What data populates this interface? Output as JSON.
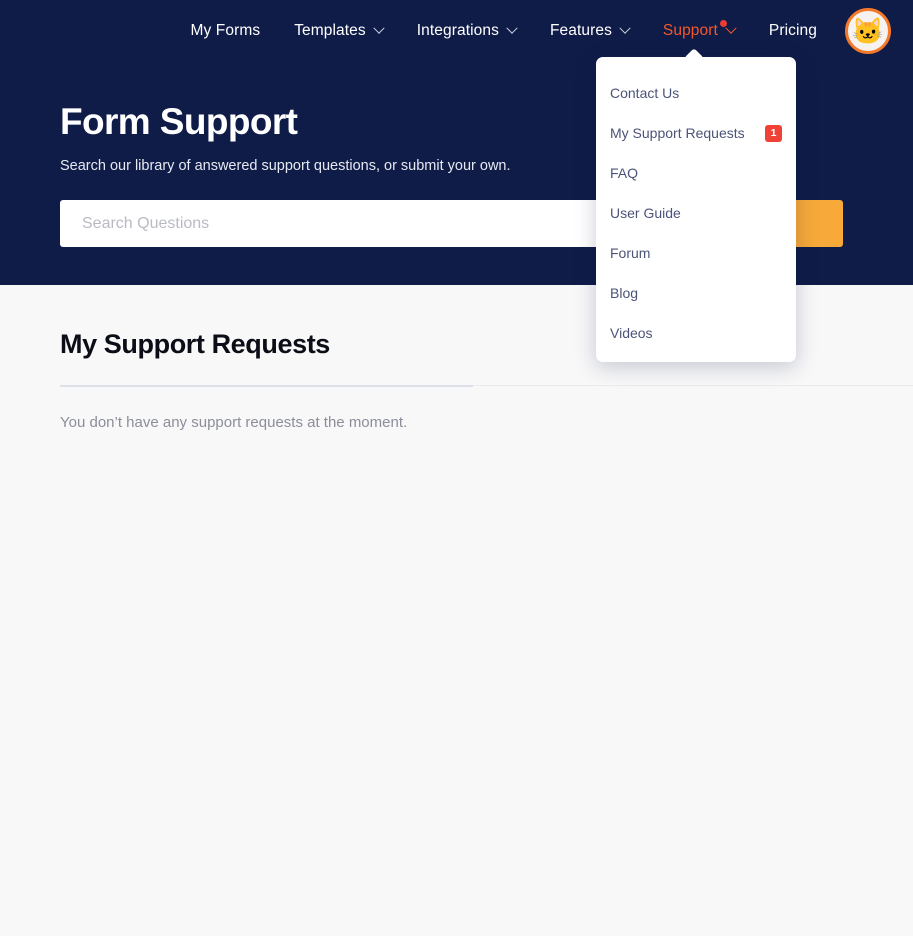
{
  "nav": {
    "items": [
      {
        "label": "My Forms",
        "has_chevron": false,
        "active": false,
        "has_dot": false
      },
      {
        "label": "Templates",
        "has_chevron": true,
        "active": false,
        "has_dot": false
      },
      {
        "label": "Integrations",
        "has_chevron": true,
        "active": false,
        "has_dot": false
      },
      {
        "label": "Features",
        "has_chevron": true,
        "active": false,
        "has_dot": false
      },
      {
        "label": "Support",
        "has_chevron": true,
        "active": true,
        "has_dot": true
      },
      {
        "label": "Pricing",
        "has_chevron": false,
        "active": false,
        "has_dot": false
      }
    ],
    "avatar_glyph": "🐱",
    "active_color": "#f4582a",
    "dot_color": "#ef3b35"
  },
  "hero": {
    "title": "Form Support",
    "subtitle": "Search our library of answered support questions, or submit your own.",
    "background_color": "#101c48"
  },
  "search": {
    "value": "",
    "placeholder": "Search Questions",
    "button_label": "",
    "button_color": "#f7a939"
  },
  "dropdown": {
    "items": [
      {
        "label": "Contact Us",
        "badge": ""
      },
      {
        "label": "My Support Requests",
        "badge": "1"
      },
      {
        "label": "FAQ",
        "badge": ""
      },
      {
        "label": "User Guide",
        "badge": ""
      },
      {
        "label": "Forum",
        "badge": ""
      },
      {
        "label": "Blog",
        "badge": ""
      },
      {
        "label": "Videos",
        "badge": ""
      }
    ],
    "badge_color": "#ef4136"
  },
  "main": {
    "section_title": "My Support Requests",
    "empty_message": "You don’t have any support requests at the moment."
  }
}
